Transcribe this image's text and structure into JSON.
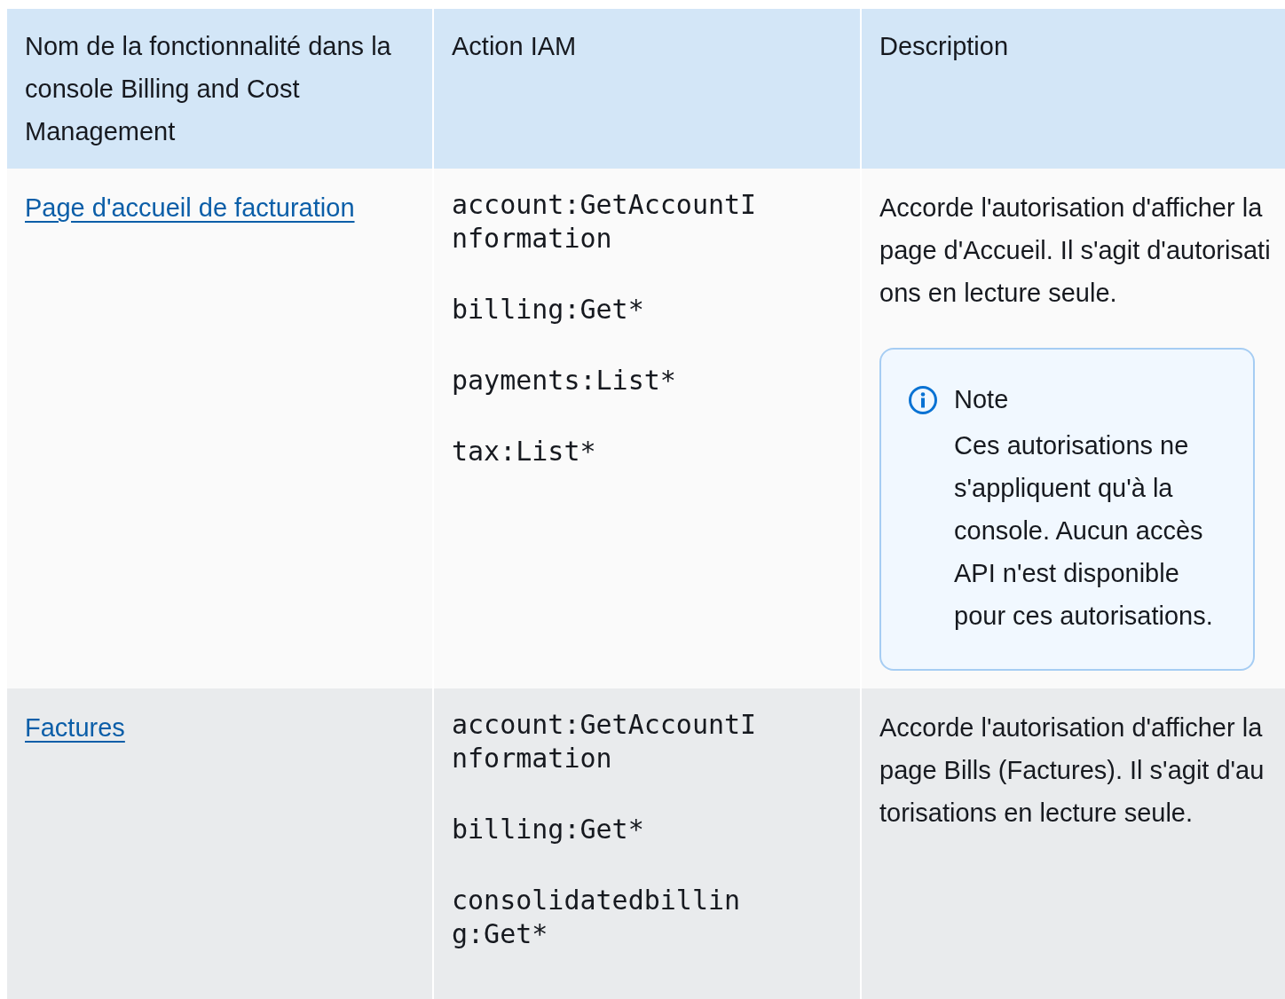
{
  "table": {
    "columns": [
      "Nom de la fonctionnalité dans la console Billing and Cost Management",
      "Action IAM",
      "Description"
    ],
    "rows": [
      {
        "feature": "Page d'accueil de facturation",
        "actions": [
          "account:GetAccountInformation",
          "billing:Get*",
          "payments:List*",
          "tax:List*"
        ],
        "description": "Accorde l'autorisation d'afficher la page d'Accueil. Il s'agit d'autorisations en lecture seule.",
        "note": {
          "title": "Note",
          "text": "Ces autorisations ne s'appliquent qu'à la console. Aucun accès API n'est disponible pour ces autorisations."
        }
      },
      {
        "feature": "Factures",
        "actions": [
          "account:GetAccountInformation",
          "billing:Get*",
          "consolidatedbilling:Get*"
        ],
        "description": "Accorde l'autorisation d'afficher la page Bills (Factures). Il s'agit d'autorisations en lecture seule."
      }
    ]
  }
}
